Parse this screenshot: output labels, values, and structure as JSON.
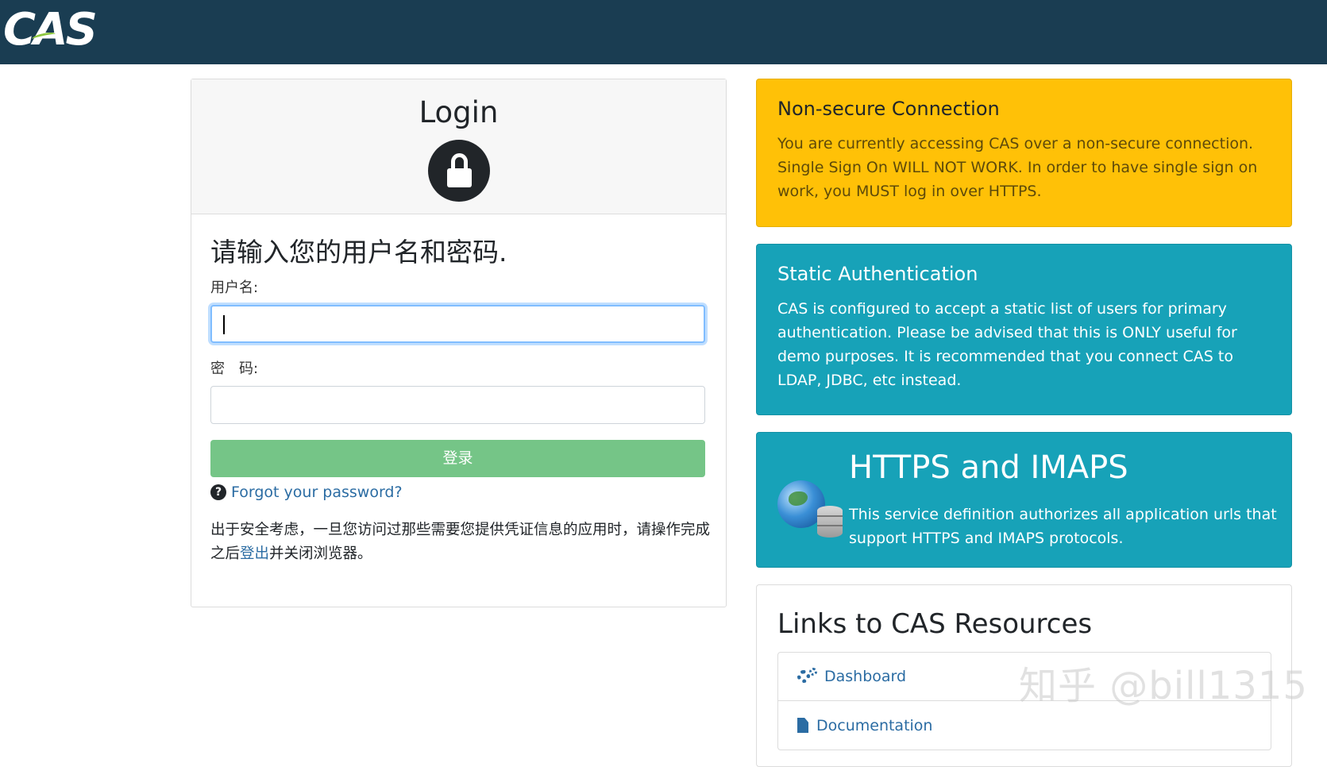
{
  "header": {
    "logo_text": "CAS"
  },
  "login": {
    "title": "Login",
    "prompt": "请输入您的用户名和密码.",
    "username_label": "用户名:",
    "username_value": "",
    "password_label": "密　码:",
    "password_value": "",
    "submit_label": "登录",
    "forgot_link": "Forgot your password?",
    "notice_before": "出于安全考虑，一旦您访问过那些需要您提供凭证信息的应用时，请操作完成之后",
    "notice_link": "登出",
    "notice_after": "并关闭浏览器。"
  },
  "alerts": {
    "nonsecure": {
      "title": "Non-secure Connection",
      "text": "You are currently accessing CAS over a non-secure connection. Single Sign On WILL NOT WORK. In order to have single sign on work, you MUST log in over HTTPS."
    },
    "static_auth": {
      "title": "Static Authentication",
      "text": "CAS is configured to accept a static list of users for primary authentication. Please be advised that this is ONLY useful for demo purposes. It is recommended that you connect CAS to LDAP, JDBC, etc instead."
    },
    "https": {
      "title": "HTTPS and IMAPS",
      "text": "This service definition authorizes all application urls that support HTTPS and IMAPS protocols."
    }
  },
  "resources": {
    "title": "Links to CAS Resources",
    "items": [
      {
        "label": "Dashboard",
        "icon": "gears-icon"
      },
      {
        "label": "Documentation",
        "icon": "file-icon"
      }
    ]
  },
  "watermark": "知乎 @bill1315",
  "colors": {
    "header_bg": "#1a3d52",
    "submit_bg": "#75c587",
    "warning_bg": "#ffc107",
    "info_bg": "#17a2b8",
    "link": "#2b6ca3"
  }
}
